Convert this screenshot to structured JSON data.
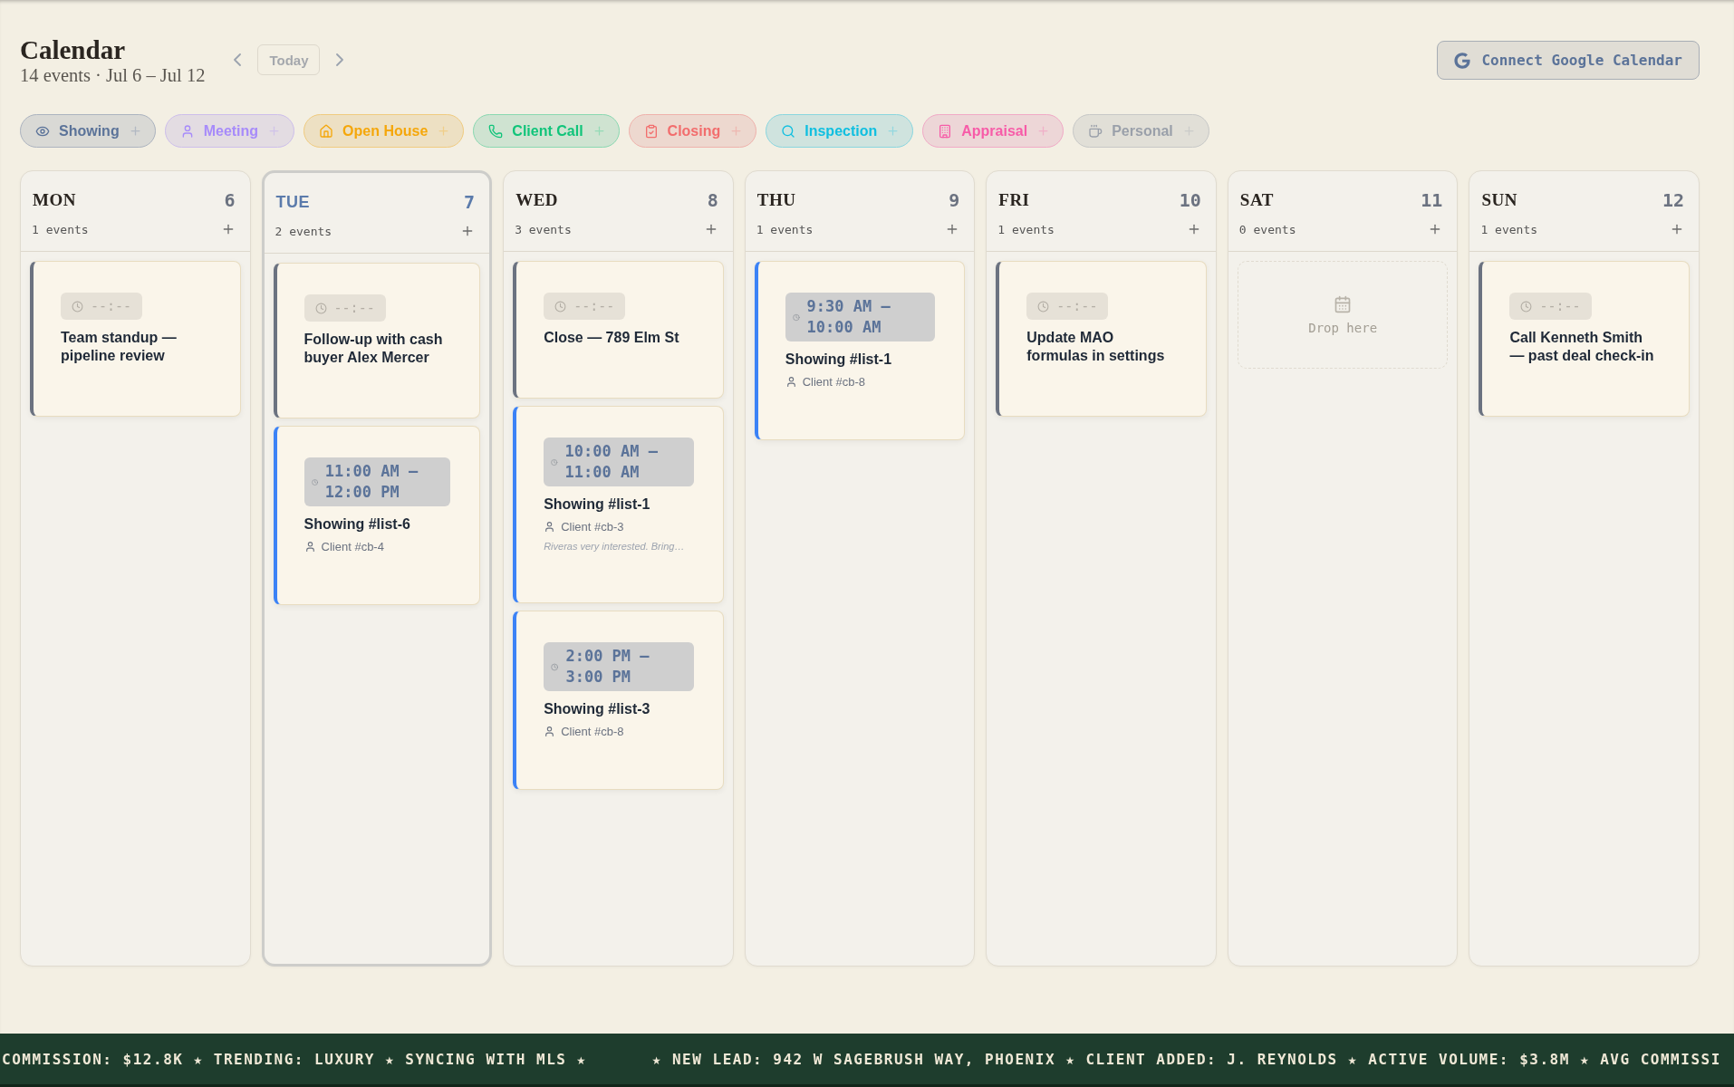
{
  "header": {
    "title": "Calendar",
    "subtitle": "14 events · Jul 6 – Jul 12",
    "today_button": "Today",
    "connect_button": "Connect Google Calendar"
  },
  "filters": [
    {
      "label": "Showing",
      "color": "#5b7399"
    },
    {
      "label": "Meeting",
      "color": "#a78bfa"
    },
    {
      "label": "Open House",
      "color": "#f5a70b"
    },
    {
      "label": "Client Call",
      "color": "#10c47a"
    },
    {
      "label": "Closing",
      "color": "#f26d6d"
    },
    {
      "label": "Inspection",
      "color": "#0fbfe0"
    },
    {
      "label": "Appraisal",
      "color": "#f75ca8"
    },
    {
      "label": "Personal",
      "color": "#9aa0aa"
    }
  ],
  "days": [
    {
      "name": "MON",
      "date": "6",
      "count": "1 events",
      "today": false,
      "events": [
        {
          "kind": "untimed",
          "time": "--:--",
          "title": "Team standup — pipeline review",
          "color": "#6b7280"
        }
      ]
    },
    {
      "name": "TUE",
      "date": "7",
      "count": "2 events",
      "today": true,
      "events": [
        {
          "kind": "untimed",
          "time": "--:--",
          "title": "Follow-up with cash buyer Alex Mercer",
          "color": "#6b7280"
        },
        {
          "kind": "timed",
          "time": "11:00 AM – 12:00 PM",
          "title": "Showing #list-6",
          "client": "Client #cb-4",
          "color": "#3b82f6"
        }
      ]
    },
    {
      "name": "WED",
      "date": "8",
      "count": "3 events",
      "today": false,
      "events": [
        {
          "kind": "untimed",
          "time": "--:--",
          "title": "Close — 789 Elm St",
          "color": "#6b7280"
        },
        {
          "kind": "timed",
          "time": "10:00 AM – 11:00 AM",
          "title": "Showing #list-1",
          "client": "Client #cb-3",
          "note": "Riveras very interested. Bring…",
          "color": "#3b82f6"
        },
        {
          "kind": "timed",
          "time": "2:00 PM – 3:00 PM",
          "title": "Showing #list-3",
          "client": "Client #cb-8",
          "color": "#3b82f6"
        }
      ]
    },
    {
      "name": "THU",
      "date": "9",
      "count": "1 events",
      "today": false,
      "events": [
        {
          "kind": "timed",
          "time": "9:30 AM – 10:00 AM",
          "title": "Showing #list-1",
          "client": "Client #cb-8",
          "color": "#3b82f6"
        }
      ]
    },
    {
      "name": "FRI",
      "date": "10",
      "count": "1 events",
      "today": false,
      "events": [
        {
          "kind": "untimed",
          "time": "--:--",
          "title": "Update MAO formulas in settings",
          "color": "#6b7280"
        }
      ]
    },
    {
      "name": "SAT",
      "date": "11",
      "count": "0 events",
      "today": false,
      "drop_hint": "Drop here"
    },
    {
      "name": "SUN",
      "date": "12",
      "count": "1 events",
      "today": false,
      "events": [
        {
          "kind": "untimed",
          "time": "--:--",
          "title": "Call Kenneth Smith — past deal check-in",
          "color": "#6b7280"
        }
      ]
    }
  ],
  "ticker": {
    "segments": [
      "COMMISSION: $12.8K ★ TRENDING: LUXURY ★ SYNCING WITH MLS ★",
      "★ NEW LEAD: 942 W SAGEBRUSH WAY, PHOENIX ★ CLIENT ADDED: J. REYNOLDS ★ ACTIVE VOLUME: $3.8M ★ AVG COMMISSI"
    ]
  }
}
